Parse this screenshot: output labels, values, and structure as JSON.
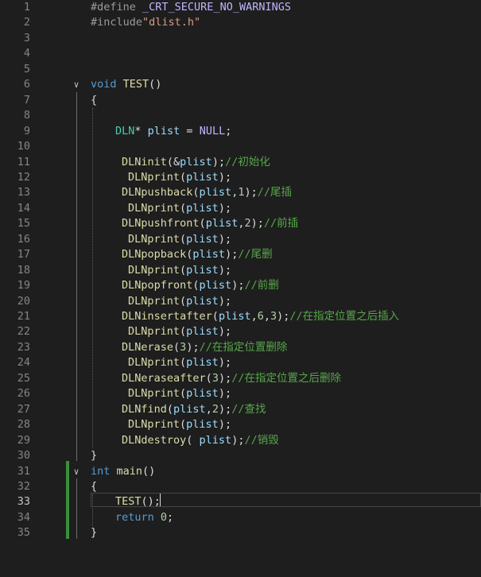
{
  "editor": {
    "active_line": 33,
    "lines": [
      {
        "n": "1",
        "indent": 0,
        "tokens": [
          {
            "t": "#define ",
            "c": "pp"
          },
          {
            "t": "_CRT_SECURE_NO_WARNINGS",
            "c": "macro"
          }
        ]
      },
      {
        "n": "2",
        "indent": 0,
        "tokens": [
          {
            "t": "#include",
            "c": "pp"
          },
          {
            "t": "\"dlist.h\"",
            "c": "str"
          }
        ]
      },
      {
        "n": "3",
        "indent": 0,
        "tokens": []
      },
      {
        "n": "4",
        "indent": 0,
        "tokens": []
      },
      {
        "n": "5",
        "indent": 0,
        "tokens": []
      },
      {
        "n": "6",
        "indent": 0,
        "fold": true,
        "tokens": [
          {
            "t": "void ",
            "c": "kw"
          },
          {
            "t": "TEST",
            "c": "fn"
          },
          {
            "t": "()",
            "c": "plain"
          }
        ]
      },
      {
        "n": "7",
        "indent": 0,
        "tokens": [
          {
            "t": "{",
            "c": "plain"
          }
        ]
      },
      {
        "n": "8",
        "indent": 0,
        "tokens": []
      },
      {
        "n": "9",
        "indent": 1,
        "tokens": [
          {
            "t": "DLN",
            "c": "ty"
          },
          {
            "t": "* ",
            "c": "plain"
          },
          {
            "t": "plist",
            "c": "var"
          },
          {
            "t": " = ",
            "c": "plain"
          },
          {
            "t": "NULL",
            "c": "macro"
          },
          {
            "t": ";",
            "c": "plain"
          }
        ]
      },
      {
        "n": "10",
        "indent": 0,
        "tokens": []
      },
      {
        "n": "11",
        "indent": 2,
        "tokens": [
          {
            "t": "DLNinit",
            "c": "fn"
          },
          {
            "t": "(&",
            "c": "plain"
          },
          {
            "t": "plist",
            "c": "var"
          },
          {
            "t": ");",
            "c": "plain"
          },
          {
            "t": "//初始化",
            "c": "cm"
          }
        ]
      },
      {
        "n": "12",
        "indent": 3,
        "tokens": [
          {
            "t": "DLNprint",
            "c": "fn"
          },
          {
            "t": "(",
            "c": "plain"
          },
          {
            "t": "plist",
            "c": "var"
          },
          {
            "t": ");",
            "c": "plain"
          }
        ]
      },
      {
        "n": "13",
        "indent": 2,
        "tokens": [
          {
            "t": "DLNpushback",
            "c": "fn"
          },
          {
            "t": "(",
            "c": "plain"
          },
          {
            "t": "plist",
            "c": "var"
          },
          {
            "t": ",",
            "c": "plain"
          },
          {
            "t": "1",
            "c": "num"
          },
          {
            "t": ");",
            "c": "plain"
          },
          {
            "t": "//尾插",
            "c": "cm"
          }
        ]
      },
      {
        "n": "14",
        "indent": 3,
        "tokens": [
          {
            "t": "DLNprint",
            "c": "fn"
          },
          {
            "t": "(",
            "c": "plain"
          },
          {
            "t": "plist",
            "c": "var"
          },
          {
            "t": ");",
            "c": "plain"
          }
        ]
      },
      {
        "n": "15",
        "indent": 2,
        "tokens": [
          {
            "t": "DLNpushfront",
            "c": "fn"
          },
          {
            "t": "(",
            "c": "plain"
          },
          {
            "t": "plist",
            "c": "var"
          },
          {
            "t": ",",
            "c": "plain"
          },
          {
            "t": "2",
            "c": "num"
          },
          {
            "t": ");",
            "c": "plain"
          },
          {
            "t": "//前插",
            "c": "cm"
          }
        ]
      },
      {
        "n": "16",
        "indent": 3,
        "tokens": [
          {
            "t": "DLNprint",
            "c": "fn"
          },
          {
            "t": "(",
            "c": "plain"
          },
          {
            "t": "plist",
            "c": "var"
          },
          {
            "t": ");",
            "c": "plain"
          }
        ]
      },
      {
        "n": "17",
        "indent": 2,
        "tokens": [
          {
            "t": "DLNpopback",
            "c": "fn"
          },
          {
            "t": "(",
            "c": "plain"
          },
          {
            "t": "plist",
            "c": "var"
          },
          {
            "t": ");",
            "c": "plain"
          },
          {
            "t": "//尾删",
            "c": "cm"
          }
        ]
      },
      {
        "n": "18",
        "indent": 3,
        "tokens": [
          {
            "t": "DLNprint",
            "c": "fn"
          },
          {
            "t": "(",
            "c": "plain"
          },
          {
            "t": "plist",
            "c": "var"
          },
          {
            "t": ");",
            "c": "plain"
          }
        ]
      },
      {
        "n": "19",
        "indent": 2,
        "tokens": [
          {
            "t": "DLNpopfront",
            "c": "fn"
          },
          {
            "t": "(",
            "c": "plain"
          },
          {
            "t": "plist",
            "c": "var"
          },
          {
            "t": ");",
            "c": "plain"
          },
          {
            "t": "//前删",
            "c": "cm"
          }
        ]
      },
      {
        "n": "20",
        "indent": 3,
        "tokens": [
          {
            "t": "DLNprint",
            "c": "fn"
          },
          {
            "t": "(",
            "c": "plain"
          },
          {
            "t": "plist",
            "c": "var"
          },
          {
            "t": ");",
            "c": "plain"
          }
        ]
      },
      {
        "n": "21",
        "indent": 2,
        "tokens": [
          {
            "t": "DLNinsertafter",
            "c": "fn"
          },
          {
            "t": "(",
            "c": "plain"
          },
          {
            "t": "plist",
            "c": "var"
          },
          {
            "t": ",",
            "c": "plain"
          },
          {
            "t": "6",
            "c": "num"
          },
          {
            "t": ",",
            "c": "plain"
          },
          {
            "t": "3",
            "c": "num"
          },
          {
            "t": ");",
            "c": "plain"
          },
          {
            "t": "//在指定位置之后插入",
            "c": "cm"
          }
        ]
      },
      {
        "n": "22",
        "indent": 3,
        "tokens": [
          {
            "t": "DLNprint",
            "c": "fn"
          },
          {
            "t": "(",
            "c": "plain"
          },
          {
            "t": "plist",
            "c": "var"
          },
          {
            "t": ");",
            "c": "plain"
          }
        ]
      },
      {
        "n": "23",
        "indent": 2,
        "tokens": [
          {
            "t": "DLNerase",
            "c": "fn"
          },
          {
            "t": "(",
            "c": "plain"
          },
          {
            "t": "3",
            "c": "num"
          },
          {
            "t": ");",
            "c": "plain"
          },
          {
            "t": "//在指定位置删除",
            "c": "cm"
          }
        ]
      },
      {
        "n": "24",
        "indent": 3,
        "tokens": [
          {
            "t": "DLNprint",
            "c": "fn"
          },
          {
            "t": "(",
            "c": "plain"
          },
          {
            "t": "plist",
            "c": "var"
          },
          {
            "t": ");",
            "c": "plain"
          }
        ]
      },
      {
        "n": "25",
        "indent": 2,
        "tokens": [
          {
            "t": "DLNeraseafter",
            "c": "fn"
          },
          {
            "t": "(",
            "c": "plain"
          },
          {
            "t": "3",
            "c": "num"
          },
          {
            "t": ");",
            "c": "plain"
          },
          {
            "t": "//在指定位置之后删除",
            "c": "cm"
          }
        ]
      },
      {
        "n": "26",
        "indent": 3,
        "tokens": [
          {
            "t": "DLNprint",
            "c": "fn"
          },
          {
            "t": "(",
            "c": "plain"
          },
          {
            "t": "plist",
            "c": "var"
          },
          {
            "t": ");",
            "c": "plain"
          }
        ]
      },
      {
        "n": "27",
        "indent": 2,
        "tokens": [
          {
            "t": "DLNfind",
            "c": "fn"
          },
          {
            "t": "(",
            "c": "plain"
          },
          {
            "t": "plist",
            "c": "var"
          },
          {
            "t": ",",
            "c": "plain"
          },
          {
            "t": "2",
            "c": "num"
          },
          {
            "t": ");",
            "c": "plain"
          },
          {
            "t": "//查找",
            "c": "cm"
          }
        ]
      },
      {
        "n": "28",
        "indent": 3,
        "tokens": [
          {
            "t": "DLNprint",
            "c": "fn"
          },
          {
            "t": "(",
            "c": "plain"
          },
          {
            "t": "plist",
            "c": "var"
          },
          {
            "t": ");",
            "c": "plain"
          }
        ]
      },
      {
        "n": "29",
        "indent": 2,
        "tokens": [
          {
            "t": "DLNdestroy",
            "c": "fn"
          },
          {
            "t": "( ",
            "c": "plain"
          },
          {
            "t": "plist",
            "c": "var"
          },
          {
            "t": ");",
            "c": "plain"
          },
          {
            "t": "//销毁",
            "c": "cm"
          }
        ]
      },
      {
        "n": "30",
        "indent": 0,
        "tokens": [
          {
            "t": "}",
            "c": "plain"
          }
        ]
      },
      {
        "n": "31",
        "indent": 0,
        "fold": true,
        "tokens": [
          {
            "t": "int ",
            "c": "kw"
          },
          {
            "t": "main",
            "c": "fn"
          },
          {
            "t": "()",
            "c": "plain"
          }
        ]
      },
      {
        "n": "32",
        "indent": 0,
        "tokens": [
          {
            "t": "{",
            "c": "plain"
          }
        ]
      },
      {
        "n": "33",
        "indent": 1,
        "tokens": [
          {
            "t": "TEST",
            "c": "fn"
          },
          {
            "t": "();",
            "c": "plain"
          }
        ]
      },
      {
        "n": "34",
        "indent": 1,
        "tokens": [
          {
            "t": "return ",
            "c": "kw"
          },
          {
            "t": "0",
            "c": "num"
          },
          {
            "t": ";",
            "c": "plain"
          }
        ]
      },
      {
        "n": "35",
        "indent": 0,
        "tokens": [
          {
            "t": "}",
            "c": "plain"
          }
        ]
      }
    ]
  },
  "icons": {
    "fold": "chevron-down-icon",
    "fold_glyph": "∨"
  }
}
